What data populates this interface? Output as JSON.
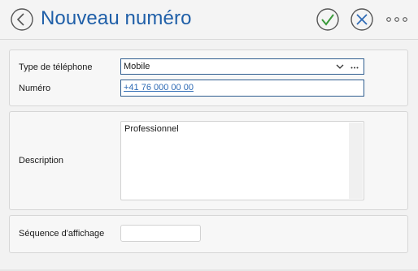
{
  "header": {
    "title": "Nouveau numéro",
    "back_icon": "back-arrow-circle-icon",
    "ok_icon": "check-circle-icon",
    "cancel_icon": "close-circle-icon",
    "more_icon": "more-horizontal-icon"
  },
  "form": {
    "phone_type": {
      "label": "Type de téléphone",
      "value": "Mobile"
    },
    "number": {
      "label": "Numéro",
      "value": "+41 76 000 00 00"
    },
    "description": {
      "label": "Description",
      "value": "Professionnel"
    },
    "display_sequence": {
      "label": "Séquence d'affichage",
      "value": ""
    }
  },
  "colors": {
    "accent": "#1f5fa8",
    "ok": "#3a9a3a",
    "cancel": "#2f6bb5",
    "border_focus": "#2f5d8f"
  }
}
